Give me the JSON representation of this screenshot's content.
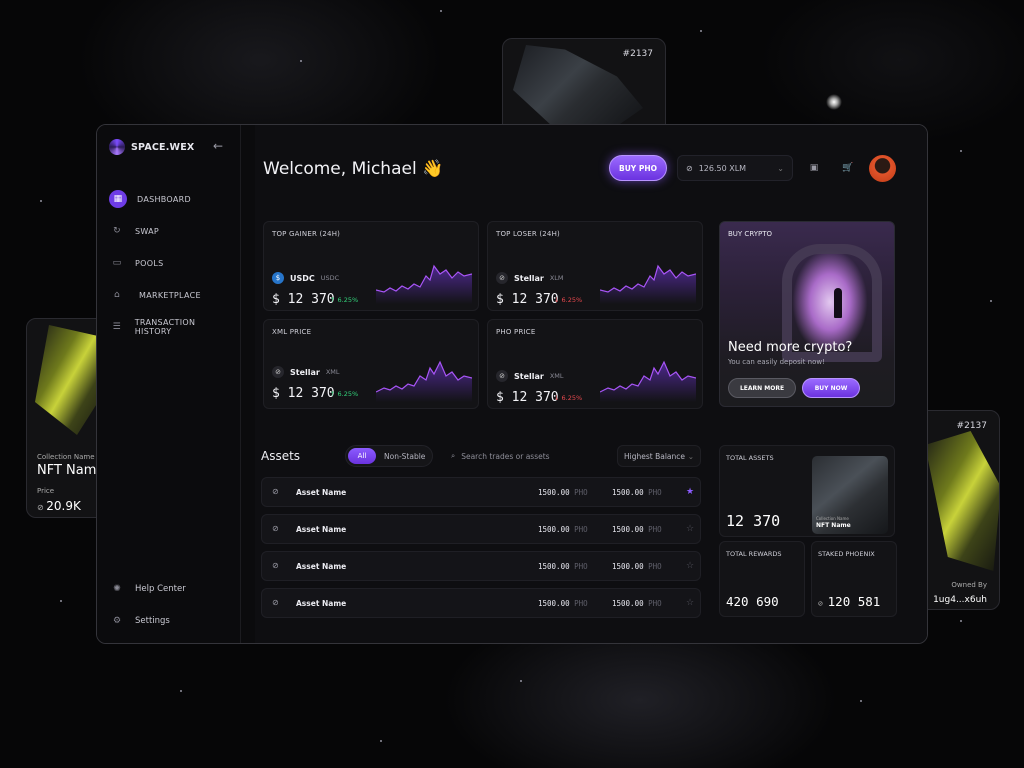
{
  "app": {
    "brand": "SPACE.WEX"
  },
  "sidebar": {
    "items": [
      {
        "label": "DASHBOARD",
        "icon": "dashboard-icon"
      },
      {
        "label": "SWAP",
        "icon": "swap-icon"
      },
      {
        "label": "POOLS",
        "icon": "pools-icon"
      },
      {
        "label": "MARKETPLACE",
        "icon": "store-icon"
      },
      {
        "label": "TRANSACTION HISTORY",
        "icon": "list-icon"
      }
    ],
    "bottom": [
      {
        "label": "Help Center",
        "icon": "help-icon"
      },
      {
        "label": "Settings",
        "icon": "gear-icon"
      }
    ]
  },
  "header": {
    "welcome": "Welcome, Michael 👋",
    "buy_label": "BUY PHO",
    "wallet_balance": "126.50 XLM"
  },
  "stats": [
    {
      "title": "TOP GAINER (24H)",
      "token": "USDC",
      "symbol": "USDC",
      "price": "$ 12 370",
      "change": "↑ 6.25%",
      "dir": "up"
    },
    {
      "title": "TOP LOSER (24H)",
      "token": "Stellar",
      "symbol": "XLM",
      "price": "$ 12 370",
      "change": "↓ 6.25%",
      "dir": "down"
    },
    {
      "title": "XML PRICE",
      "token": "Stellar",
      "symbol": "XML",
      "price": "$ 12 370",
      "change": "↑ 6.25%",
      "dir": "up"
    },
    {
      "title": "PHO PRICE",
      "token": "Stellar",
      "symbol": "XML",
      "price": "$ 12 370",
      "change": "↓ 6.25%",
      "dir": "down"
    }
  ],
  "promo": {
    "title": "BUY CRYPTO",
    "headline": "Need more crypto?",
    "sub": "You can easily deposit now!",
    "learn_more": "LEARN MORE",
    "buy_now": "BUY NOW"
  },
  "assets": {
    "title": "Assets",
    "filter_all": "All",
    "filter_nonstable": "Non-Stable",
    "search_placeholder": "Search trades or assets",
    "sort": "Highest Balance",
    "rows": [
      {
        "name": "Asset Name",
        "v1": "1500.00",
        "u1": "PHO",
        "v2": "1500.00",
        "u2": "PHO",
        "fav": true
      },
      {
        "name": "Asset Name",
        "v1": "1500.00",
        "u1": "PHO",
        "v2": "1500.00",
        "u2": "PHO",
        "fav": false
      },
      {
        "name": "Asset Name",
        "v1": "1500.00",
        "u1": "PHO",
        "v2": "1500.00",
        "u2": "PHO",
        "fav": false
      },
      {
        "name": "Asset Name",
        "v1": "1500.00",
        "u1": "PHO",
        "v2": "1500.00",
        "u2": "PHO",
        "fav": false
      }
    ]
  },
  "totals": {
    "total_assets_label": "TOTAL ASSETS",
    "total_assets_value": "12 370",
    "nft_collection": "Collection Name",
    "nft_name": "NFT Name",
    "total_rewards_label": "TOTAL REWARDS",
    "total_rewards_value": "420 690",
    "staked_label": "STAKED PHOENIX",
    "staked_value": "120 581"
  },
  "floating": {
    "top_tag": "#2137",
    "right_tag": "#2137",
    "right_owned_label": "Owned By",
    "right_owner": "1ug4...x6uh",
    "left_collection": "Collection Name",
    "left_name": "NFT Name",
    "left_price_label": "Price",
    "left_price": "20.9K"
  },
  "colors": {
    "accent": "#7c4dff",
    "up": "#33d17a",
    "down": "#e5484d"
  }
}
